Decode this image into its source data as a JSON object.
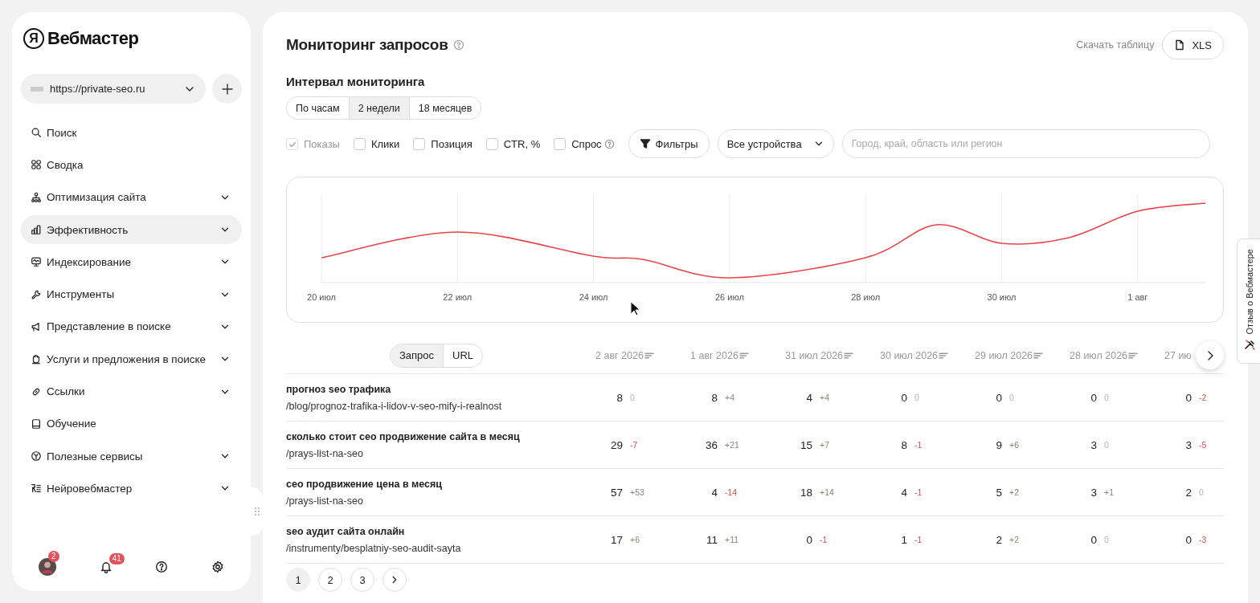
{
  "sidebar": {
    "logo": {
      "mark": "Я",
      "name": "Вебмастер"
    },
    "site": {
      "url": "https://private-seo.ru"
    },
    "nav": [
      {
        "label": "Поиск",
        "expandable": false,
        "selected": false
      },
      {
        "label": "Сводка",
        "expandable": false,
        "selected": false
      },
      {
        "label": "Оптимизация сайта",
        "expandable": true,
        "selected": false
      },
      {
        "label": "Эффективность",
        "expandable": true,
        "selected": true
      },
      {
        "label": "Индексирование",
        "expandable": true,
        "selected": false
      },
      {
        "label": "Инструменты",
        "expandable": true,
        "selected": false
      },
      {
        "label": "Представление в поиске",
        "expandable": true,
        "selected": false
      },
      {
        "label": "Услуги и предложения в поиске",
        "expandable": true,
        "selected": false
      },
      {
        "label": "Ссылки",
        "expandable": true,
        "selected": false
      },
      {
        "label": "Обучение",
        "expandable": false,
        "selected": false
      },
      {
        "label": "Полезные сервисы",
        "expandable": true,
        "selected": false
      },
      {
        "label": "Нейровебмастер",
        "expandable": true,
        "selected": false
      }
    ],
    "footer": {
      "profile_badge": "2",
      "notifications_badge": "41"
    }
  },
  "feedback_tab": {
    "label": "Отзыв о Вебмастере"
  },
  "page": {
    "title": "Мониторинг запросов",
    "download_label": "Скачать таблицу",
    "download_button": "XLS",
    "interval_title": "Интервал мониторинга",
    "intervals": [
      {
        "label": "По часам",
        "selected": false
      },
      {
        "label": "2 недели",
        "selected": true
      },
      {
        "label": "18 месяцев",
        "selected": false
      }
    ],
    "metrics": [
      {
        "label": "Показы",
        "checked": true,
        "disabled": true,
        "help": false
      },
      {
        "label": "Клики",
        "checked": false,
        "disabled": false,
        "help": false
      },
      {
        "label": "Позиция",
        "checked": false,
        "disabled": false,
        "help": false
      },
      {
        "label": "CTR, %",
        "checked": false,
        "disabled": false,
        "help": false
      },
      {
        "label": "Спрос",
        "checked": false,
        "disabled": false,
        "help": true
      }
    ],
    "filters_button": "Фильтры",
    "device_select": "Все устройства",
    "region_placeholder": "Город, край, область или регион"
  },
  "chart": {
    "x_labels": [
      "20 июл",
      "22 июл",
      "24 июл",
      "26 июл",
      "28 июл",
      "30 июл",
      "1 авг"
    ]
  },
  "table": {
    "modes": [
      {
        "label": "Запрос",
        "selected": true
      },
      {
        "label": "URL",
        "selected": false
      }
    ],
    "columns": [
      {
        "label": "2 авг 2026",
        "sort_icon": true
      },
      {
        "label": "1 авг 2026",
        "sort_icon": true
      },
      {
        "label": "31 июл 2026",
        "sort_icon": true
      },
      {
        "label": "30 июл 2026",
        "sort_icon": true
      },
      {
        "label": "29 июл 2026",
        "sort_icon": true
      },
      {
        "label": "28 июл 2026",
        "sort_icon": true
      },
      {
        "label": "27 ию",
        "sort_icon": false
      }
    ],
    "rows": [
      {
        "query": "прогноз seo трафика",
        "url": "/blog/prognoz-trafika-i-lidov-v-seo-mify-i-realnost",
        "cells": [
          {
            "value": "8",
            "delta": "0",
            "kind": "flat"
          },
          {
            "value": "8",
            "delta": "+4",
            "kind": "up"
          },
          {
            "value": "4",
            "delta": "+4",
            "kind": "up"
          },
          {
            "value": "0",
            "delta": "0",
            "kind": "flat"
          },
          {
            "value": "0",
            "delta": "0",
            "kind": "flat"
          },
          {
            "value": "0",
            "delta": "0",
            "kind": "flat"
          },
          {
            "value": "0",
            "delta": "-2",
            "kind": "down"
          }
        ]
      },
      {
        "query": "сколько стоит сео продвижение сайта в месяц",
        "url": "/prays-list-na-seo",
        "cells": [
          {
            "value": "29",
            "delta": "-7",
            "kind": "down"
          },
          {
            "value": "36",
            "delta": "+21",
            "kind": "up"
          },
          {
            "value": "15",
            "delta": "+7",
            "kind": "up"
          },
          {
            "value": "8",
            "delta": "-1",
            "kind": "down"
          },
          {
            "value": "9",
            "delta": "+6",
            "kind": "up"
          },
          {
            "value": "3",
            "delta": "0",
            "kind": "flat"
          },
          {
            "value": "3",
            "delta": "-5",
            "kind": "down"
          }
        ]
      },
      {
        "query": "сео продвижение цена в месяц",
        "url": "/prays-list-na-seo",
        "cells": [
          {
            "value": "57",
            "delta": "+53",
            "kind": "up"
          },
          {
            "value": "4",
            "delta": "-14",
            "kind": "down"
          },
          {
            "value": "18",
            "delta": "+14",
            "kind": "up"
          },
          {
            "value": "4",
            "delta": "-1",
            "kind": "down"
          },
          {
            "value": "5",
            "delta": "+2",
            "kind": "up"
          },
          {
            "value": "3",
            "delta": "+1",
            "kind": "up"
          },
          {
            "value": "2",
            "delta": "0",
            "kind": "flat"
          }
        ]
      },
      {
        "query": "seo аудит сайта онлайн",
        "url": "/instrumenty/besplatniy-seo-audit-sayta",
        "cells": [
          {
            "value": "17",
            "delta": "+6",
            "kind": "up"
          },
          {
            "value": "11",
            "delta": "+11",
            "kind": "up"
          },
          {
            "value": "0",
            "delta": "-1",
            "kind": "down"
          },
          {
            "value": "1",
            "delta": "-1",
            "kind": "down"
          },
          {
            "value": "2",
            "delta": "+2",
            "kind": "up"
          },
          {
            "value": "0",
            "delta": "0",
            "kind": "flat"
          },
          {
            "value": "0",
            "delta": "-3",
            "kind": "down"
          }
        ]
      }
    ]
  },
  "pagination": {
    "pages": [
      {
        "label": "1",
        "selected": true
      },
      {
        "label": "2",
        "selected": false
      },
      {
        "label": "3",
        "selected": false
      }
    ]
  }
}
